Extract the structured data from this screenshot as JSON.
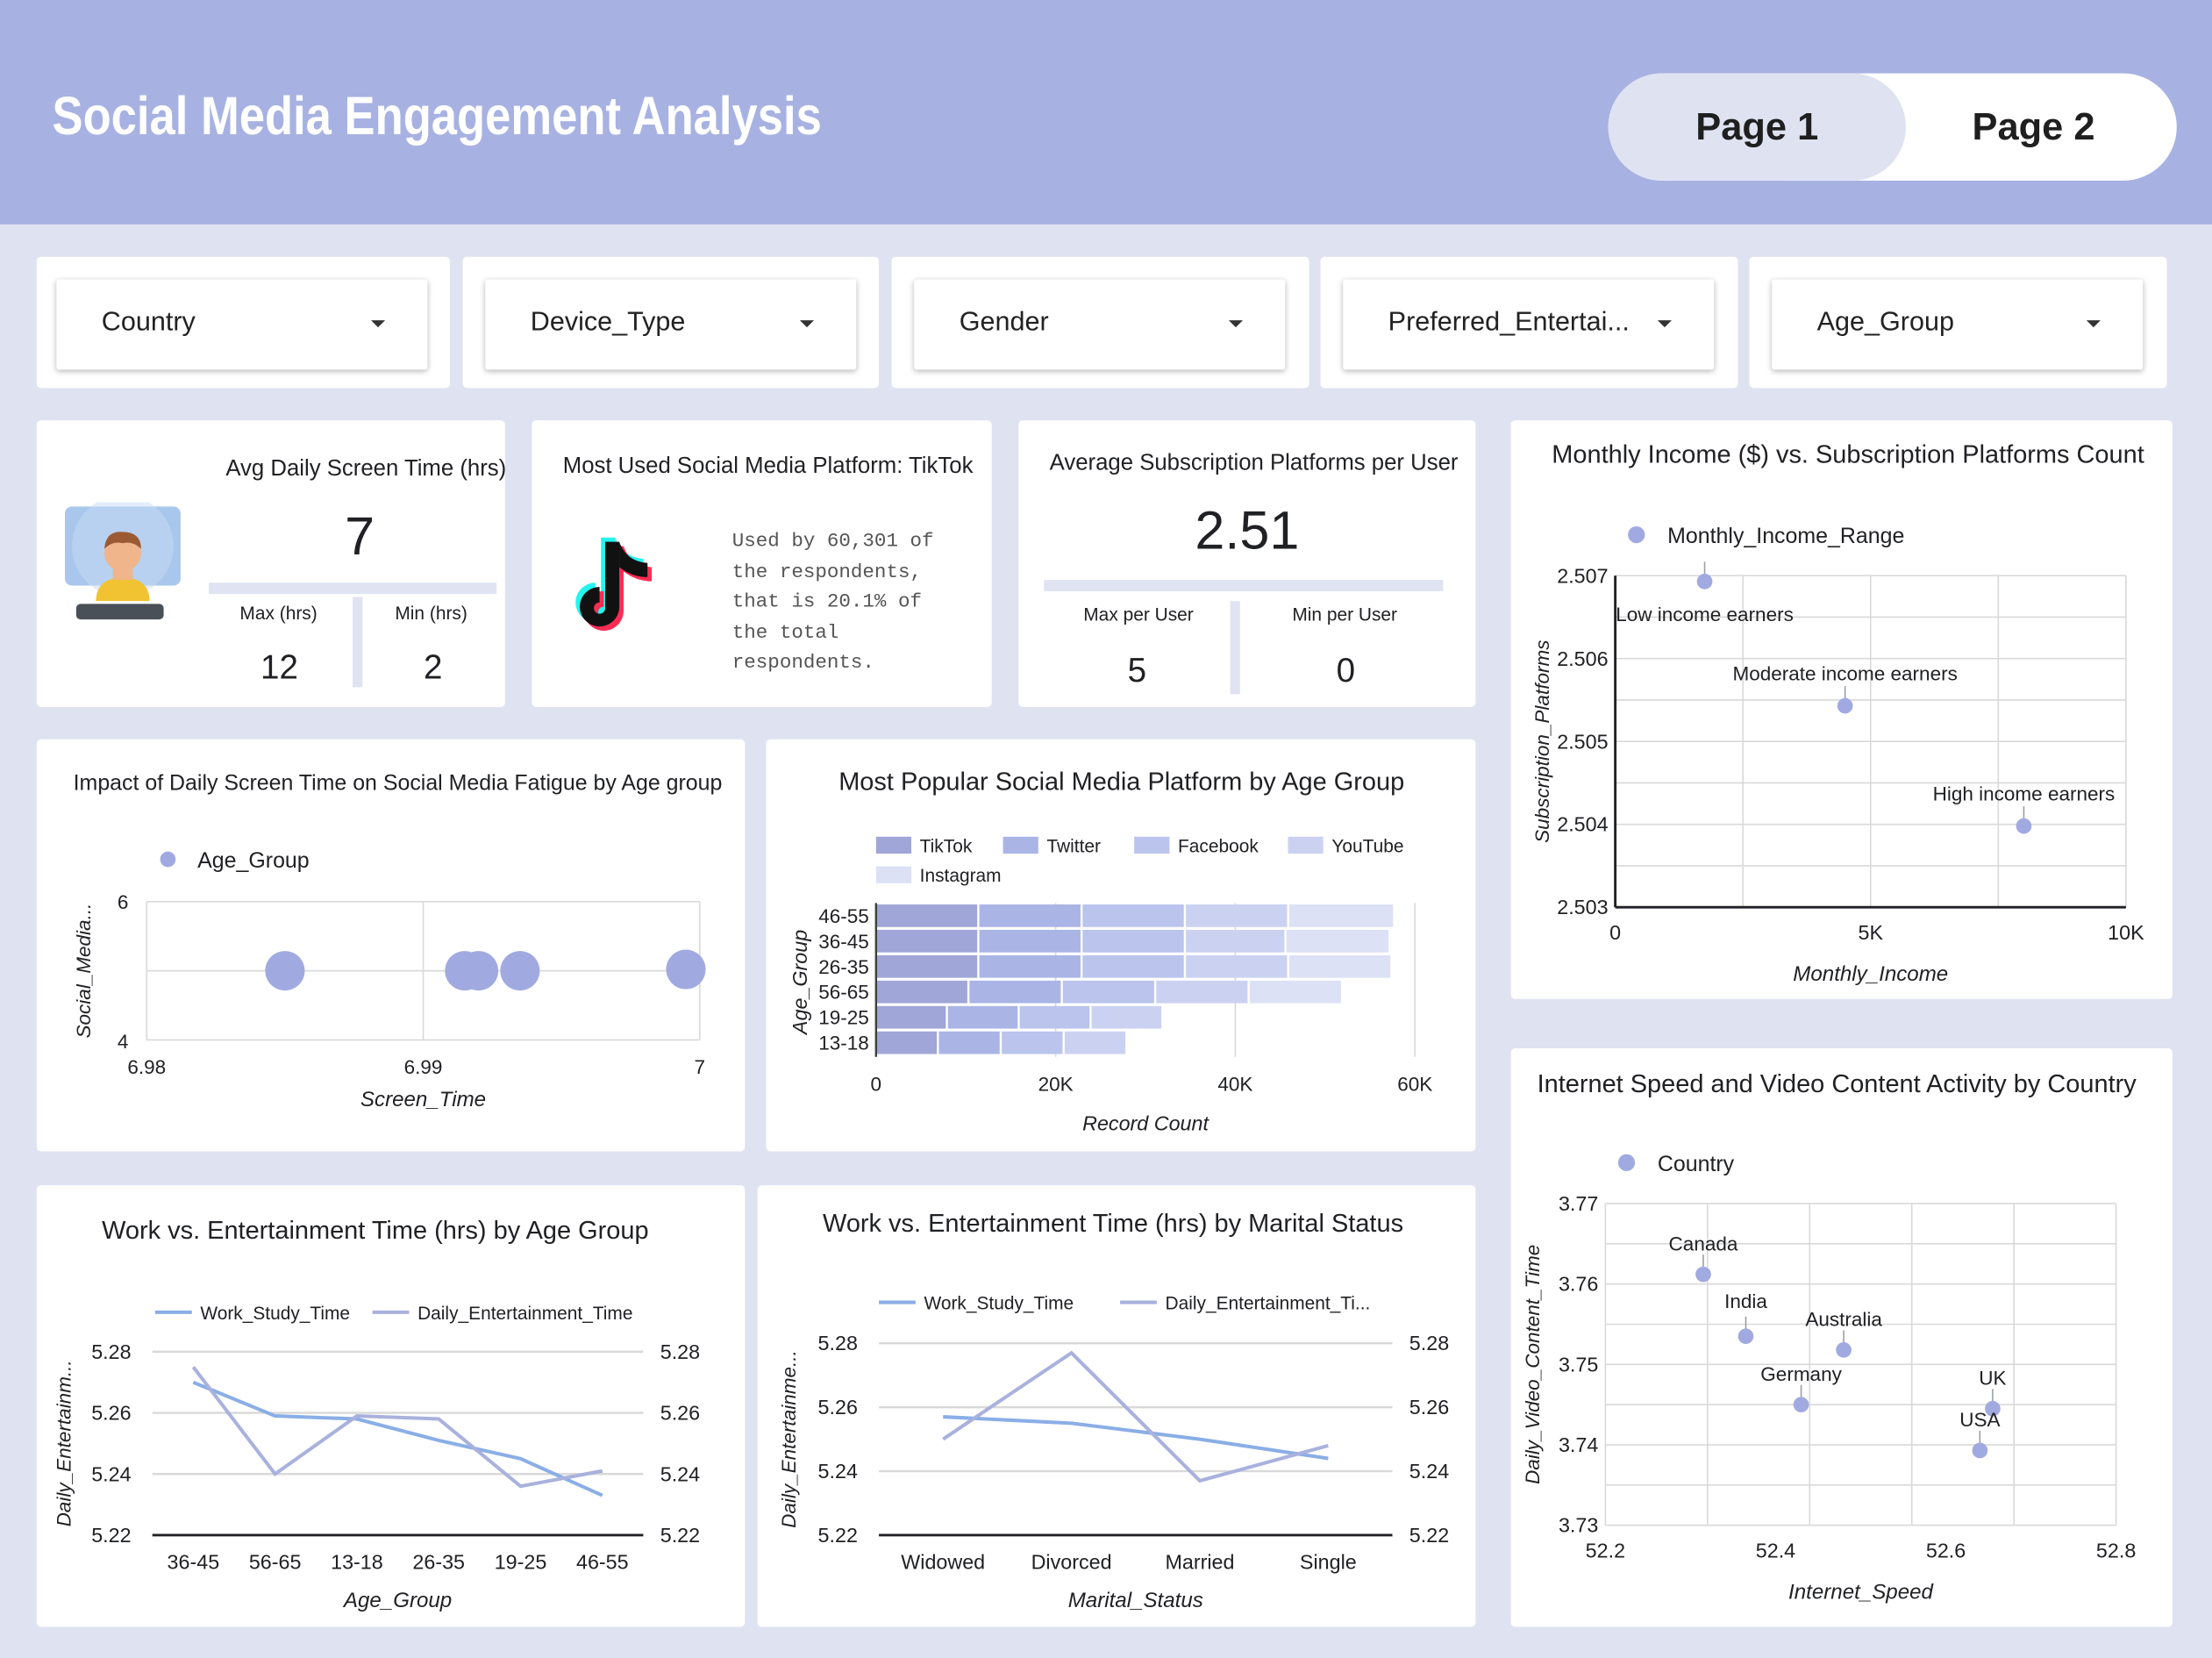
{
  "header": {
    "title": "Social Media Engagement Analysis",
    "page1": "Page 1",
    "page2": "Page 2"
  },
  "colors": {
    "header_bg": "#a7b2e2",
    "page_bg": "#dfe2f1",
    "accent": "#a1aae0",
    "line1": "#8aaee6",
    "line2": "#a9b1dd"
  },
  "filters": [
    "Country",
    "Device_Type",
    "Gender",
    "Preferred_Entertai...",
    "Age_Group"
  ],
  "kpi_screen": {
    "title": "Avg Daily Screen Time (hrs)",
    "value": "7",
    "max_label": "Max (hrs)",
    "max": "12",
    "min_label": "Min (hrs)",
    "min": "2",
    "icon": "person-at-computer-icon"
  },
  "kpi_platform": {
    "title": "Most Used Social Media Platform: TikTok",
    "text": [
      "Used by 60,301 of",
      "the respondents,",
      "that is 20.1% of",
      "the total",
      "respondents."
    ],
    "icon": "tiktok-logo-icon"
  },
  "kpi_subs": {
    "title": "Average Subscription Platforms per User",
    "value": "2.51",
    "max_label": "Max per User",
    "max": "5",
    "min_label": "Min per User",
    "min": "0"
  },
  "chart_data": [
    {
      "type": "scatter",
      "title": "Impact of Daily Screen Time on Social Media Fatigue by Age group",
      "xlabel": "Screen_Time",
      "ylabel": "Social_Media...",
      "legend": "Age_Group",
      "xlim": [
        6.98,
        7
      ],
      "ylim": [
        4,
        6
      ],
      "xticks": [
        "6.98",
        "6.99",
        "7"
      ],
      "yticks": [
        "4",
        "6"
      ],
      "points": [
        {
          "x": 6.985,
          "y": 5
        },
        {
          "x": 6.9915,
          "y": 5
        },
        {
          "x": 6.992,
          "y": 5
        },
        {
          "x": 6.9935,
          "y": 5
        },
        {
          "x": 6.9995,
          "y": 5.02
        }
      ]
    },
    {
      "type": "bar",
      "stacked": true,
      "orientation": "horizontal",
      "title": "Most Popular Social Media Platform by Age Group",
      "xlabel": "Record Count",
      "ylabel": "Age_Group",
      "xlim": [
        0,
        60000
      ],
      "xticks": [
        "0",
        "20K",
        "40K",
        "60K"
      ],
      "categories": [
        "46-55",
        "36-45",
        "26-35",
        "56-65",
        "19-25",
        "13-18"
      ],
      "series": [
        {
          "name": "TikTok",
          "color": "#a1a6d8",
          "values": [
            11500,
            11500,
            11500,
            10400,
            8000,
            7000
          ]
        },
        {
          "name": "Twitter",
          "color": "#aab5e6",
          "values": [
            11500,
            11500,
            11500,
            10400,
            8000,
            7000
          ]
        },
        {
          "name": "Facebook",
          "color": "#bac4ec",
          "values": [
            11500,
            11500,
            11500,
            10400,
            8000,
            7000
          ]
        },
        {
          "name": "YouTube",
          "color": "#cbd2f1",
          "values": [
            11500,
            11200,
            11500,
            10400,
            8000,
            7000
          ]
        },
        {
          "name": "Instagram",
          "color": "#dde1f5",
          "values": [
            11800,
            11600,
            11500,
            10400,
            0,
            0
          ]
        }
      ]
    },
    {
      "type": "line",
      "title": "Work vs. Entertainment Time (hrs) by Age Group",
      "xlabel": "Age_Group",
      "ylabel": "Daily_Entertainm...",
      "ylim": [
        5.22,
        5.28
      ],
      "yticks": [
        "5.22",
        "5.24",
        "5.26",
        "5.28"
      ],
      "categories": [
        "36-45",
        "56-65",
        "13-18",
        "26-35",
        "19-25",
        "46-55"
      ],
      "series": [
        {
          "name": "Work_Study_Time",
          "color": "#8aaee6",
          "values": [
            5.27,
            5.259,
            5.258,
            5.251,
            5.245,
            5.233
          ]
        },
        {
          "name": "Daily_Entertainment_Time",
          "color": "#a9b1dd",
          "values": [
            5.275,
            5.24,
            5.259,
            5.258,
            5.236,
            5.241
          ]
        }
      ]
    },
    {
      "type": "line",
      "title": "Work vs. Entertainment Time (hrs) by Marital Status",
      "xlabel": "Marital_Status",
      "ylabel": "Daily_Entertainme...",
      "ylim": [
        5.22,
        5.28
      ],
      "yticks": [
        "5.22",
        "5.24",
        "5.26",
        "5.28"
      ],
      "categories": [
        "Widowed",
        "Divorced",
        "Married",
        "Single"
      ],
      "legend_labels": [
        "Work_Study_Time",
        "Daily_Entertainment_Ti..."
      ],
      "series": [
        {
          "name": "Work_Study_Time",
          "color": "#8aaee6",
          "values": [
            5.257,
            5.255,
            5.25,
            5.244
          ]
        },
        {
          "name": "Daily_Entertainment_Time",
          "color": "#a9b1dd",
          "values": [
            5.25,
            5.277,
            5.237,
            5.248
          ]
        }
      ]
    },
    {
      "type": "scatter",
      "title": "Monthly Income ($) vs. Subscription Platforms Count",
      "xlabel": "Monthly_Income",
      "ylabel": "Subscription_Platforms",
      "legend": "Monthly_Income_Range",
      "xlim": [
        0,
        10000
      ],
      "ylim": [
        2.503,
        2.507
      ],
      "xticks": [
        "0",
        "5K",
        "10K"
      ],
      "yticks": [
        "2.503",
        "2.504",
        "2.505",
        "2.506",
        "2.507"
      ],
      "points": [
        {
          "x": 1750,
          "y": 2.50693,
          "label": "Low income earners"
        },
        {
          "x": 4500,
          "y": 2.50543,
          "label": "Moderate income earners"
        },
        {
          "x": 8000,
          "y": 2.50398,
          "label": "High income earners"
        }
      ]
    },
    {
      "type": "scatter",
      "title": "Internet Speed and Video Content Activity by Country",
      "xlabel": "Internet_Speed",
      "ylabel": "Daily_Video_Content_Time",
      "legend": "Country",
      "xlim": [
        52.2,
        52.8
      ],
      "ylim": [
        3.73,
        3.77
      ],
      "xticks": [
        "52.2",
        "52.4",
        "52.6",
        "52.8"
      ],
      "yticks": [
        "3.73",
        "3.74",
        "3.75",
        "3.76",
        "3.77"
      ],
      "points": [
        {
          "x": 52.315,
          "y": 3.7612,
          "label": "Canada"
        },
        {
          "x": 52.365,
          "y": 3.7535,
          "label": "India"
        },
        {
          "x": 52.48,
          "y": 3.7518,
          "label": "Australia"
        },
        {
          "x": 52.43,
          "y": 3.745,
          "label": "Germany"
        },
        {
          "x": 52.655,
          "y": 3.7445,
          "label": "UK"
        },
        {
          "x": 52.64,
          "y": 3.7393,
          "label": "USA"
        }
      ]
    }
  ]
}
